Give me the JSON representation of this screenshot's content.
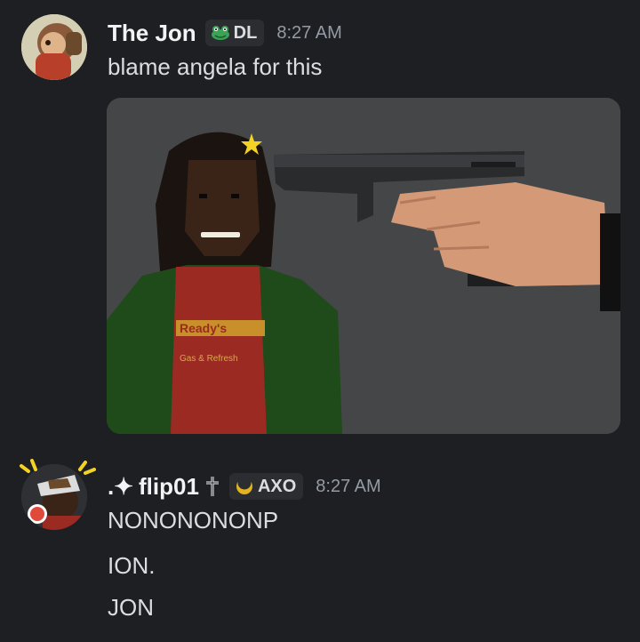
{
  "messages": [
    {
      "author": "The Jon",
      "tag": "DL",
      "tag_icon": "frog-icon",
      "timestamp": "8:27 AM",
      "text": "blame angela for this",
      "attachment": {
        "type": "image",
        "description_icon": "meme-image",
        "shirt_text_1": "Ready's",
        "shirt_text_2": "Gas & Refresh"
      }
    },
    {
      "author_prefix": ".✦",
      "author": "flip01",
      "author_suffix_icon": "cross-icon",
      "tag": "AXO",
      "tag_icon": "crescent-icon",
      "timestamp": "8:27 AM",
      "lines": [
        "NONONONONP",
        "ION.",
        "JON"
      ]
    }
  ],
  "colors": {
    "background": "#1e1f22",
    "username": "#f2f3f5",
    "text": "#dbdee1",
    "timestamp": "#949ba4",
    "tag_bg": "#2b2d31"
  }
}
